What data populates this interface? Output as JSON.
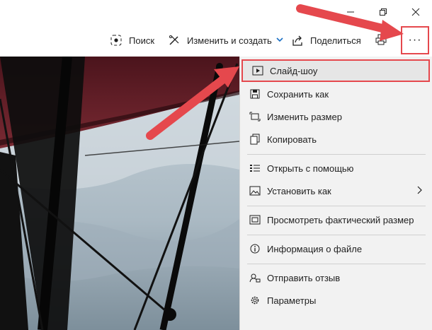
{
  "window": {
    "min_icon": "minimize-icon",
    "max_icon": "maximize-icon",
    "close_icon": "close-icon"
  },
  "toolbar": {
    "search_label": "Поиск",
    "edit_label": "Изменить и создать",
    "share_label": "Поделиться",
    "more_label": "···"
  },
  "menu": {
    "items": [
      {
        "label": "Слайд-шоу",
        "icon": "slideshow-icon"
      },
      {
        "label": "Сохранить как",
        "icon": "save-icon"
      },
      {
        "label": "Изменить размер",
        "icon": "resize-icon"
      },
      {
        "label": "Копировать",
        "icon": "copy-icon"
      },
      {
        "label": "Открыть с помощью",
        "icon": "open-with-icon"
      },
      {
        "label": "Установить как",
        "icon": "set-as-icon"
      },
      {
        "label": "Просмотреть фактический размер",
        "icon": "actual-size-icon"
      },
      {
        "label": "Информация о файле",
        "icon": "info-icon"
      },
      {
        "label": "Отправить отзыв",
        "icon": "feedback-icon"
      },
      {
        "label": "Параметры",
        "icon": "settings-icon"
      }
    ]
  },
  "colors": {
    "highlight": "#e5484d",
    "accent": "#1a6fc4",
    "menu_bg": "#f2f2f2"
  }
}
